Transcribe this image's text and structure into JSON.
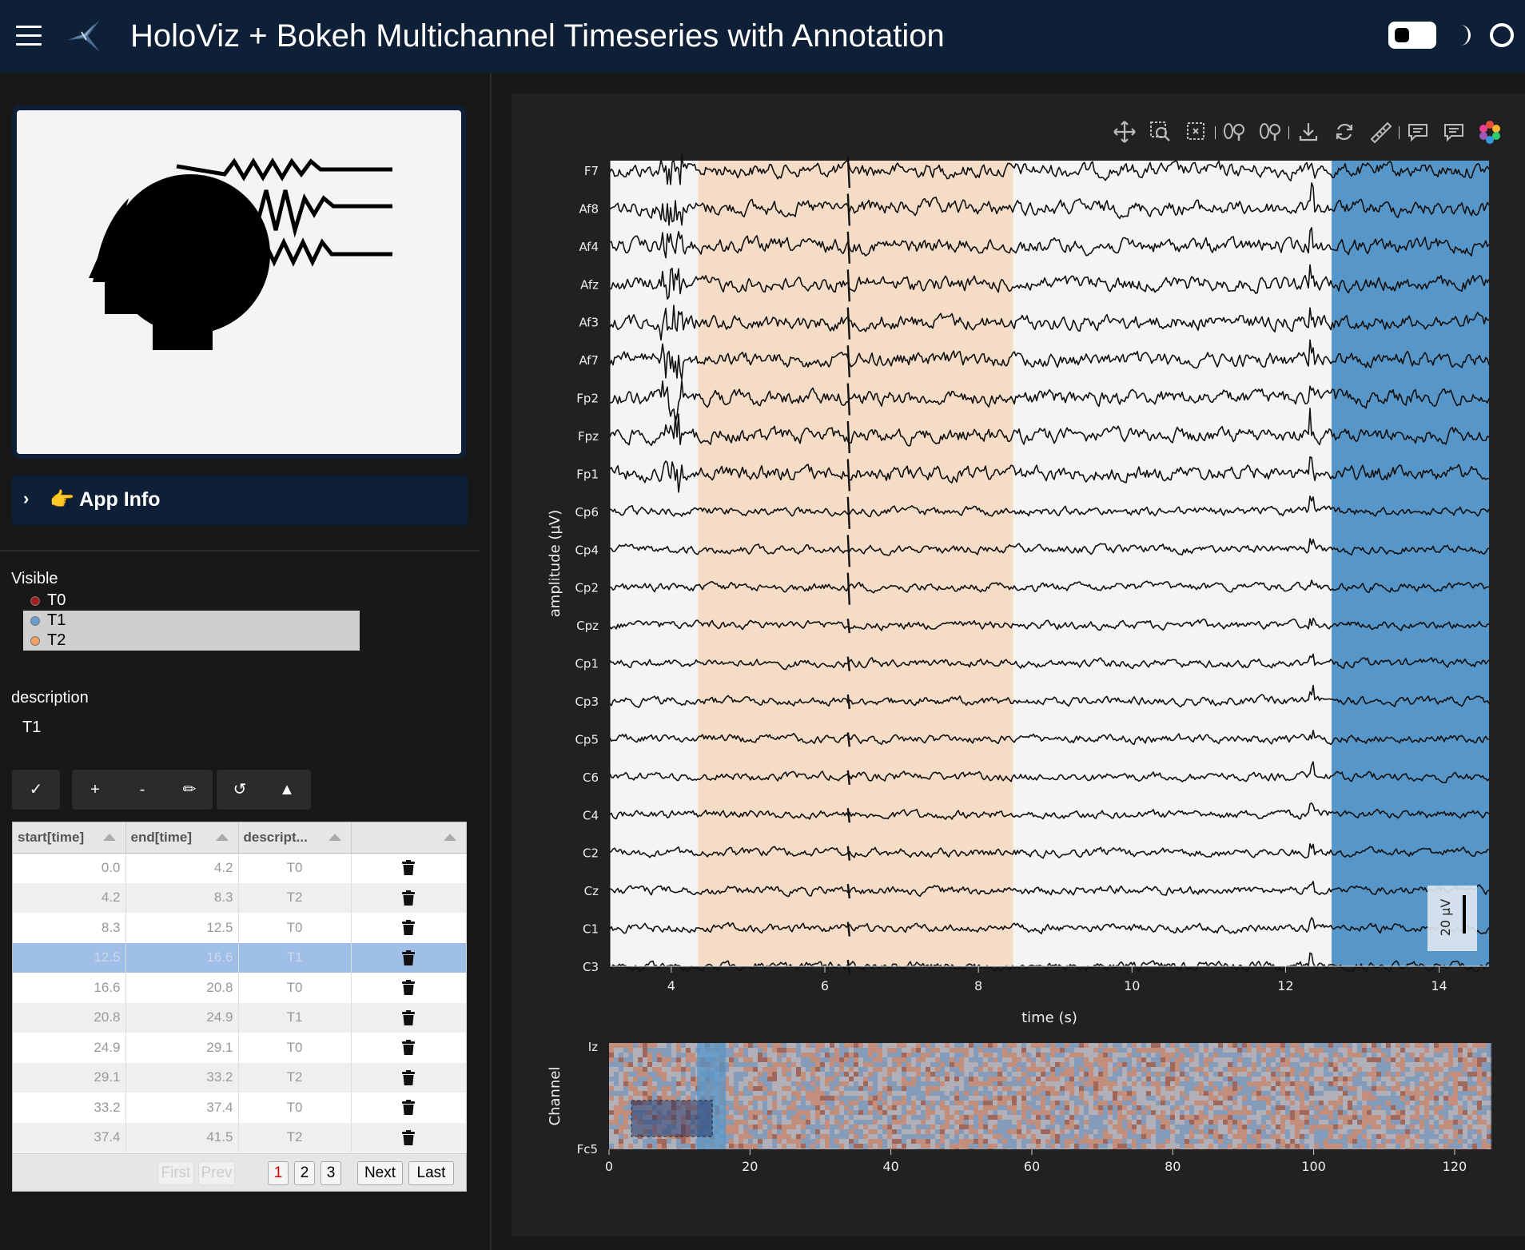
{
  "header": {
    "title": "HoloViz + Bokeh Multichannel Timeseries with Annotation"
  },
  "sidebar": {
    "app_info_label": "👉 App Info",
    "visible_label": "Visible",
    "visible_options": [
      {
        "label": "T0",
        "color": "#a02020",
        "selected": false
      },
      {
        "label": "T1",
        "color": "#6a9ed0",
        "selected": true
      },
      {
        "label": "T2",
        "color": "#f3a060",
        "selected": true
      }
    ],
    "description_label": "description",
    "description_value": "T1",
    "buttons": {
      "apply": "✓",
      "add": "+",
      "remove": "-",
      "edit": "✏",
      "undo": "↺",
      "up": "▲"
    },
    "table": {
      "headers": [
        "start[time]",
        "end[time]",
        "descript...",
        ""
      ],
      "rows": [
        {
          "start": "0.0",
          "end": "4.2",
          "description": "T0"
        },
        {
          "start": "4.2",
          "end": "8.3",
          "description": "T2"
        },
        {
          "start": "8.3",
          "end": "12.5",
          "description": "T0"
        },
        {
          "start": "12.5",
          "end": "16.6",
          "description": "T1",
          "selected": true
        },
        {
          "start": "16.6",
          "end": "20.8",
          "description": "T0"
        },
        {
          "start": "20.8",
          "end": "24.9",
          "description": "T1"
        },
        {
          "start": "24.9",
          "end": "29.1",
          "description": "T0"
        },
        {
          "start": "29.1",
          "end": "33.2",
          "description": "T2"
        },
        {
          "start": "33.2",
          "end": "37.4",
          "description": "T0"
        },
        {
          "start": "37.4",
          "end": "41.5",
          "description": "T2"
        }
      ],
      "pager": {
        "first": "First",
        "prev": "Prev",
        "pages": [
          "1",
          "2",
          "3"
        ],
        "current_page": "1",
        "next": "Next",
        "last": "Last"
      }
    }
  },
  "toolbar": {
    "tools": [
      "pan-icon",
      "box-zoom-icon",
      "box-select-icon",
      "x-wheel-zoom-icon",
      "y-wheel-zoom-icon",
      "save-icon",
      "reset-icon",
      "ruler-icon",
      "hover-icon",
      "hover-icon-2",
      "bokeh-logo-icon"
    ]
  },
  "main_plot": {
    "ylabel": "amplitude (µV)",
    "xlabel": "time (s)",
    "channels": [
      "F7",
      "Af8",
      "Af4",
      "Afz",
      "Af3",
      "Af7",
      "Fp2",
      "Fpz",
      "Fp1",
      "Cp6",
      "Cp4",
      "Cp2",
      "Cpz",
      "Cp1",
      "Cp3",
      "Cp5",
      "C6",
      "C4",
      "C2",
      "Cz",
      "C1",
      "C3"
    ],
    "xlim": [
      3.2,
      14.65
    ],
    "xticks": [
      "4",
      "6",
      "8",
      "10",
      "12",
      "14"
    ],
    "xtick_values": [
      4,
      6,
      8,
      10,
      12,
      14
    ],
    "scale_bar": "20 µV",
    "annotations": [
      {
        "start": 4.35,
        "end": 8.45,
        "label": "T2",
        "color": "#f5dcc6"
      },
      {
        "start": 12.6,
        "end": 16.6,
        "label": "T1",
        "color": "#5796c8"
      }
    ]
  },
  "minimap": {
    "ylabel": "Channel",
    "yticks": [
      "Iz",
      "Fc5"
    ],
    "xlim": [
      0,
      125
    ],
    "xticks": [
      "0",
      "20",
      "40",
      "60",
      "80",
      "100",
      "120"
    ],
    "xtick_values": [
      0,
      20,
      40,
      60,
      80,
      100,
      120
    ],
    "highlight": {
      "start": 12.5,
      "end": 16.6
    },
    "selection": {
      "start": 3.2,
      "end": 14.65
    }
  },
  "chart_data": {
    "type": "line",
    "title": "",
    "xlabel": "time (s)",
    "ylabel": "amplitude (µV)",
    "xlim": [
      3.2,
      14.65
    ],
    "categories": [
      "F7",
      "Af8",
      "Af4",
      "Afz",
      "Af3",
      "Af7",
      "Fp2",
      "Fpz",
      "Fp1",
      "Cp6",
      "Cp4",
      "Cp2",
      "Cpz",
      "Cp1",
      "Cp3",
      "Cp5",
      "C6",
      "C4",
      "C2",
      "Cz",
      "C1",
      "C3"
    ],
    "grid": false
  }
}
